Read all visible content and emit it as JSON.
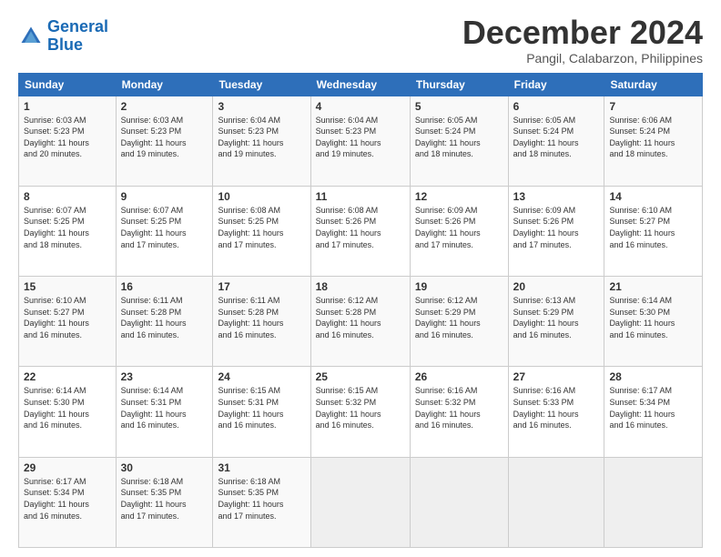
{
  "header": {
    "logo_line1": "General",
    "logo_line2": "Blue",
    "month_title": "December 2024",
    "location": "Pangil, Calabarzon, Philippines"
  },
  "columns": [
    "Sunday",
    "Monday",
    "Tuesday",
    "Wednesday",
    "Thursday",
    "Friday",
    "Saturday"
  ],
  "weeks": [
    [
      {
        "day": "1",
        "info": "Sunrise: 6:03 AM\nSunset: 5:23 PM\nDaylight: 11 hours\nand 20 minutes."
      },
      {
        "day": "2",
        "info": "Sunrise: 6:03 AM\nSunset: 5:23 PM\nDaylight: 11 hours\nand 19 minutes."
      },
      {
        "day": "3",
        "info": "Sunrise: 6:04 AM\nSunset: 5:23 PM\nDaylight: 11 hours\nand 19 minutes."
      },
      {
        "day": "4",
        "info": "Sunrise: 6:04 AM\nSunset: 5:23 PM\nDaylight: 11 hours\nand 19 minutes."
      },
      {
        "day": "5",
        "info": "Sunrise: 6:05 AM\nSunset: 5:24 PM\nDaylight: 11 hours\nand 18 minutes."
      },
      {
        "day": "6",
        "info": "Sunrise: 6:05 AM\nSunset: 5:24 PM\nDaylight: 11 hours\nand 18 minutes."
      },
      {
        "day": "7",
        "info": "Sunrise: 6:06 AM\nSunset: 5:24 PM\nDaylight: 11 hours\nand 18 minutes."
      }
    ],
    [
      {
        "day": "8",
        "info": "Sunrise: 6:07 AM\nSunset: 5:25 PM\nDaylight: 11 hours\nand 18 minutes."
      },
      {
        "day": "9",
        "info": "Sunrise: 6:07 AM\nSunset: 5:25 PM\nDaylight: 11 hours\nand 17 minutes."
      },
      {
        "day": "10",
        "info": "Sunrise: 6:08 AM\nSunset: 5:25 PM\nDaylight: 11 hours\nand 17 minutes."
      },
      {
        "day": "11",
        "info": "Sunrise: 6:08 AM\nSunset: 5:26 PM\nDaylight: 11 hours\nand 17 minutes."
      },
      {
        "day": "12",
        "info": "Sunrise: 6:09 AM\nSunset: 5:26 PM\nDaylight: 11 hours\nand 17 minutes."
      },
      {
        "day": "13",
        "info": "Sunrise: 6:09 AM\nSunset: 5:26 PM\nDaylight: 11 hours\nand 17 minutes."
      },
      {
        "day": "14",
        "info": "Sunrise: 6:10 AM\nSunset: 5:27 PM\nDaylight: 11 hours\nand 16 minutes."
      }
    ],
    [
      {
        "day": "15",
        "info": "Sunrise: 6:10 AM\nSunset: 5:27 PM\nDaylight: 11 hours\nand 16 minutes."
      },
      {
        "day": "16",
        "info": "Sunrise: 6:11 AM\nSunset: 5:28 PM\nDaylight: 11 hours\nand 16 minutes."
      },
      {
        "day": "17",
        "info": "Sunrise: 6:11 AM\nSunset: 5:28 PM\nDaylight: 11 hours\nand 16 minutes."
      },
      {
        "day": "18",
        "info": "Sunrise: 6:12 AM\nSunset: 5:28 PM\nDaylight: 11 hours\nand 16 minutes."
      },
      {
        "day": "19",
        "info": "Sunrise: 6:12 AM\nSunset: 5:29 PM\nDaylight: 11 hours\nand 16 minutes."
      },
      {
        "day": "20",
        "info": "Sunrise: 6:13 AM\nSunset: 5:29 PM\nDaylight: 11 hours\nand 16 minutes."
      },
      {
        "day": "21",
        "info": "Sunrise: 6:14 AM\nSunset: 5:30 PM\nDaylight: 11 hours\nand 16 minutes."
      }
    ],
    [
      {
        "day": "22",
        "info": "Sunrise: 6:14 AM\nSunset: 5:30 PM\nDaylight: 11 hours\nand 16 minutes."
      },
      {
        "day": "23",
        "info": "Sunrise: 6:14 AM\nSunset: 5:31 PM\nDaylight: 11 hours\nand 16 minutes."
      },
      {
        "day": "24",
        "info": "Sunrise: 6:15 AM\nSunset: 5:31 PM\nDaylight: 11 hours\nand 16 minutes."
      },
      {
        "day": "25",
        "info": "Sunrise: 6:15 AM\nSunset: 5:32 PM\nDaylight: 11 hours\nand 16 minutes."
      },
      {
        "day": "26",
        "info": "Sunrise: 6:16 AM\nSunset: 5:32 PM\nDaylight: 11 hours\nand 16 minutes."
      },
      {
        "day": "27",
        "info": "Sunrise: 6:16 AM\nSunset: 5:33 PM\nDaylight: 11 hours\nand 16 minutes."
      },
      {
        "day": "28",
        "info": "Sunrise: 6:17 AM\nSunset: 5:34 PM\nDaylight: 11 hours\nand 16 minutes."
      }
    ],
    [
      {
        "day": "29",
        "info": "Sunrise: 6:17 AM\nSunset: 5:34 PM\nDaylight: 11 hours\nand 16 minutes."
      },
      {
        "day": "30",
        "info": "Sunrise: 6:18 AM\nSunset: 5:35 PM\nDaylight: 11 hours\nand 17 minutes."
      },
      {
        "day": "31",
        "info": "Sunrise: 6:18 AM\nSunset: 5:35 PM\nDaylight: 11 hours\nand 17 minutes."
      },
      {
        "day": "",
        "info": ""
      },
      {
        "day": "",
        "info": ""
      },
      {
        "day": "",
        "info": ""
      },
      {
        "day": "",
        "info": ""
      }
    ]
  ]
}
